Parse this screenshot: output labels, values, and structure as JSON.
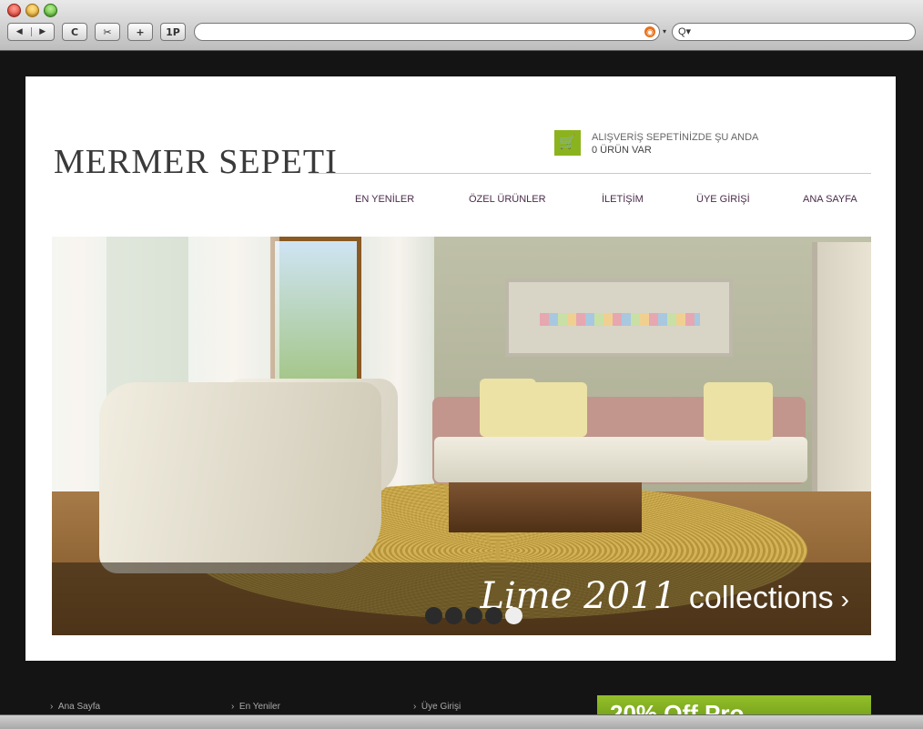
{
  "browser": {
    "nav_back": "◀",
    "nav_forward": "▶",
    "reload": "C",
    "snap": "✂",
    "add": "+",
    "onep": "1P",
    "url": "",
    "search_prefix": "Q▾"
  },
  "site": {
    "logo": "MERMER SEPETI",
    "cart": {
      "line1": "ALIŞVERİŞ SEPETİNİZDE ŞU ANDA",
      "line2": "0 ÜRÜN VAR",
      "icon": "cart-icon"
    },
    "menu": [
      "EN YENİLER",
      "ÖZEL ÜRÜNLER",
      "İLETİŞİM",
      "ÜYE GİRİŞİ",
      "ANA SAYFA"
    ],
    "hero": {
      "script_text": "Lime 2011",
      "text": "collections",
      "arrow": "›",
      "dots": 5,
      "active_dot": 5
    }
  },
  "footer": {
    "links": [
      "Ana Sayfa",
      "En Yeniler",
      "Üye Girişi"
    ],
    "banner": "20% Off Pro"
  },
  "colors": {
    "accent": "#8bb31e",
    "menu_text": "#4a2c4a",
    "page_bg": "#141414"
  }
}
